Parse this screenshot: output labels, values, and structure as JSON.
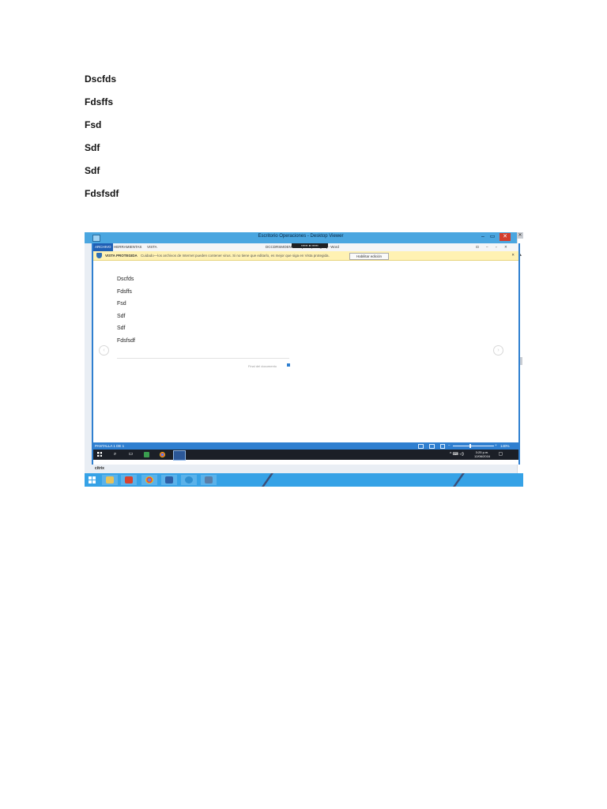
{
  "document": {
    "lines": [
      "Dscfds",
      "Fdsffs",
      "Fsd",
      "Sdf",
      "Sdf",
      "Fdsfsdf"
    ]
  },
  "screenshot": {
    "outer_window": {
      "title": "Escritorio Operaciones - Desktop Viewer",
      "controls": [
        "–",
        "▭",
        "✕"
      ],
      "close_glyph": "✕"
    },
    "remote_bar_text": "▪▪▪▪▪▪ ● ▪▪▪▪▪▪",
    "word": {
      "tabs": [
        "ARCHIVO",
        "HERRAMIENTAS",
        "VISTA"
      ],
      "doc_title": "DCCDRSMOENV22.0 [Vista protegida] - Word",
      "window_buttons": [
        "⊡",
        "–",
        "▫",
        "✕"
      ],
      "protected_view": {
        "title": "VISTA PROTEGIDA",
        "message": "Cuidado—los archivos de Internet pueden contener virus. Si no tiene que editarlo, es mejor que siga en Vista protegida.",
        "button": "Habilitar edición",
        "close": "✕"
      },
      "page_lines": [
        "Dscfds",
        "Fdsffs",
        "Fsd",
        "Sdf",
        "Sdf",
        "Fdsfsdf"
      ],
      "nav_prev": "‹",
      "nav_next": "›",
      "end_of_document": "Final del documento",
      "status": {
        "page_label": "PANTALLA 1 DE 1",
        "zoom_minus": "–",
        "zoom_plus": "+",
        "zoom": "140%",
        "zoom_fraction": 0.4
      }
    },
    "inner_taskbar": {
      "search_glyph": "⌕",
      "task_glyph": "▭",
      "tray_icons": "^ ⌨ ◁)",
      "clock_time": "3:25 p.m.",
      "clock_date": "12/06/2016",
      "notification_glyph": "▢"
    },
    "bottom_label": "citrix",
    "outer_taskbar": {
      "pinned_icons": [
        "folder-icon",
        "media-icon",
        "chrome-icon",
        "people-icon",
        "network-icon",
        "monitor-icon"
      ]
    },
    "colors": {
      "title_bar": "#4aa6e0",
      "word_blue": "#2f7fd0",
      "warning_yellow": "#fff2b3",
      "taskbar_dark": "#1b1f27",
      "taskbar_blue": "#36a2e6"
    }
  }
}
